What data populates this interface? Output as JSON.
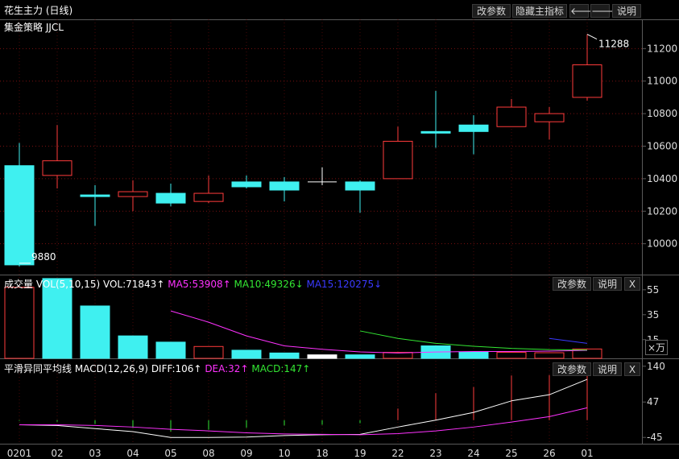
{
  "colors": {
    "up": "#ff3b3b",
    "down": "#3ff0f0",
    "white": "#ffffff",
    "ma5": "#ff32ff",
    "ma10": "#33e633",
    "ma15": "#3a3aff",
    "grid": "#7a1010",
    "frame": "#5a5a5a",
    "dif": "#ffffff",
    "dea": "#ff32ff"
  },
  "header": {
    "title": "花生主力 (日线)",
    "strategy": "集金策略 JJCL",
    "btn_params": "改参数",
    "btn_hide": "隐藏主指标",
    "btn_left_icon": "arrow-left-icon",
    "btn_right_icon": "arrow-right-icon",
    "btn_help": "说明"
  },
  "vol_panel": {
    "title": "成交量",
    "name": "VOL(5,10,15)",
    "vol_label": "VOL:71843",
    "vol_arrow": "↑",
    "ma5_label": "MA5:53908",
    "ma5_arrow": "↑",
    "ma10_label": "MA10:49326",
    "ma10_arrow": "↓",
    "ma15_label": "MA15:120275",
    "ma15_arrow": "↓",
    "btn_params": "改参数",
    "btn_help": "说明",
    "btn_close": "X",
    "unit_label": "×万"
  },
  "macd_panel": {
    "title": "平滑异同平均线",
    "name": "MACD(12,26,9)",
    "dif_label": "DIFF:106",
    "dif_arrow": "↑",
    "dea_label": "DEA:32",
    "dea_arrow": "↑",
    "macd_label": "MACD:147",
    "macd_arrow": "↑",
    "btn_params": "改参数",
    "btn_help": "说明",
    "btn_close": "X"
  },
  "chart_data": [
    {
      "type": "candlestick",
      "title": "花生主力 (日线)",
      "categories": [
        "0201",
        "02",
        "03",
        "04",
        "05",
        "08",
        "09",
        "10",
        "18",
        "19",
        "22",
        "23",
        "24",
        "25",
        "26",
        "01"
      ],
      "open": [
        10480,
        10420,
        10300,
        10290,
        10310,
        10260,
        10380,
        10380,
        10380,
        10380,
        10400,
        10690,
        10730,
        10720,
        10750,
        10900
      ],
      "high": [
        10620,
        10730,
        10360,
        10390,
        10370,
        10420,
        10420,
        10410,
        10470,
        10390,
        10720,
        10940,
        10790,
        10890,
        10840,
        11288
      ],
      "close": [
        9870,
        10510,
        10290,
        10320,
        10250,
        10310,
        10350,
        10330,
        10380,
        10330,
        10630,
        10680,
        10690,
        10840,
        10800,
        11100
      ],
      "low": [
        9860,
        10340,
        10110,
        10200,
        10230,
        10250,
        10340,
        10260,
        10360,
        10190,
        10400,
        10590,
        10550,
        10720,
        10640,
        10880
      ],
      "ylim": [
        9830,
        11360
      ],
      "yticks": [
        10000,
        10200,
        10400,
        10600,
        10800,
        11000,
        11200
      ],
      "annotations": [
        {
          "label": "9880",
          "value": 9880,
          "index": 0
        },
        {
          "label": "11288",
          "value": 11288,
          "index": 15
        }
      ]
    },
    {
      "type": "bar",
      "title": "成交量",
      "categories": [
        "0201",
        "02",
        "03",
        "04",
        "05",
        "08",
        "09",
        "10",
        "18",
        "19",
        "22",
        "23",
        "24",
        "25",
        "26",
        "01"
      ],
      "values": [
        57000,
        64000,
        42000,
        18000,
        13000,
        9500,
        6500,
        4300,
        2800,
        2800,
        4800,
        10000,
        5000,
        4800,
        4500,
        7500
      ],
      "up": [
        true,
        false,
        false,
        false,
        false,
        true,
        false,
        false,
        null,
        false,
        true,
        false,
        false,
        true,
        true,
        true
      ],
      "ma5": [
        null,
        null,
        null,
        null,
        38000,
        29000,
        18000,
        10000,
        7300,
        5200,
        4300,
        5100,
        5500,
        5500,
        5800,
        6400
      ],
      "ma10": [
        null,
        null,
        null,
        null,
        null,
        null,
        null,
        null,
        null,
        22000,
        16000,
        12000,
        9700,
        8000,
        7000,
        6700
      ],
      "ma15": [
        null,
        null,
        null,
        null,
        null,
        null,
        null,
        null,
        null,
        null,
        null,
        null,
        null,
        null,
        16000,
        12000
      ],
      "yticks": [
        15,
        35,
        55
      ],
      "ylim": [
        0,
        62000
      ]
    },
    {
      "type": "bar",
      "title": "平滑异同平均线",
      "categories": [
        "0201",
        "02",
        "03",
        "04",
        "05",
        "08",
        "09",
        "10",
        "18",
        "19",
        "22",
        "23",
        "24",
        "25",
        "26",
        "01"
      ],
      "macd": [
        -2,
        -4,
        -10,
        -20,
        -30,
        -25,
        -20,
        -14,
        -12,
        -8,
        30,
        70,
        86,
        116,
        117,
        147
      ],
      "dif": [
        -12,
        -14,
        -22,
        -30,
        -45,
        -45,
        -44,
        -40,
        -38,
        -37,
        -18,
        0,
        20,
        50,
        66,
        106
      ],
      "dea": [
        -12,
        -12,
        -14,
        -18,
        -24,
        -28,
        -33,
        -36,
        -37,
        -38,
        -35,
        -28,
        -18,
        -5,
        9,
        32
      ],
      "yticks": [
        -45,
        47,
        140
      ],
      "ylim": [
        -55,
        150
      ]
    }
  ]
}
